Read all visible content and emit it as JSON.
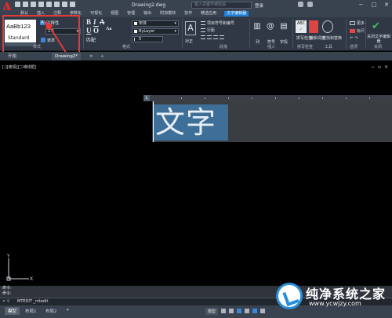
{
  "app": {
    "window_title": "Drawing2.dwg",
    "search_placeholder": "键入关键字或短语",
    "signin_label": "登录",
    "logo_letter": "A"
  },
  "ribbon_tabs": [
    "默认",
    "插入",
    "注释",
    "参数化",
    "可视化",
    "视图",
    "管理",
    "输出",
    "附加模块",
    "协作",
    "精选应用",
    "文字编辑器"
  ],
  "ribbon_active_tab": "文字编辑器",
  "ribbon": {
    "style": {
      "sample_text": "AaBb123",
      "sample_name": "Standard",
      "annotative_label": "注释性",
      "text_height": "2.5",
      "mask_label": "遮罩",
      "group_label": "样式"
    },
    "format": {
      "bold": "B",
      "italic": "I",
      "strike": "A",
      "underline": "U",
      "overline": "O",
      "case": "Aa",
      "font_value": "宋体",
      "color_value": "ByLayer",
      "oblique_value": "0",
      "match_label": "匹配",
      "group_label": "格式"
    },
    "paragraph": {
      "justify_label": "对正",
      "bullets_label": "项目符号和编号",
      "line_spacing_label": "行距",
      "group_label": "段落"
    },
    "insert": {
      "columns_label": "列",
      "symbol_label": "符号",
      "field_label": "字段",
      "group_label": "插入"
    },
    "spell": {
      "spell_check_label": "拼写检查",
      "edit_dict_label": "编辑词典",
      "find_replace_label": "查找和替换",
      "group_label": "拼写检查",
      "tools_label": "工具"
    },
    "options": {
      "more_label": "更多",
      "ruler_label": "标尺",
      "group_label": "选项"
    },
    "close": {
      "close_label": "关闭文字编辑器",
      "group_label": "关闭"
    }
  },
  "document_tabs": [
    {
      "label": "开始",
      "active": false
    },
    {
      "label": "Drawing2*",
      "active": true
    }
  ],
  "canvas": {
    "view_controls": "[-][俯视][二维线框]",
    "editor_text": "文字"
  },
  "command": {
    "history": [
      "命令:",
      "命令:"
    ],
    "current": "MTEDIT _mtedit"
  },
  "layout_tabs": [
    {
      "label": "模型",
      "active": true
    },
    {
      "label": "布局1",
      "active": false
    },
    {
      "label": "布局2",
      "active": false
    }
  ],
  "status": {
    "model_label": "模型"
  },
  "watermark": {
    "title": "纯净系统之家",
    "url": "www.ycwjzy.com"
  },
  "colors": {
    "accent": "#1f80d6",
    "highlight_border": "#e53935",
    "selection": "#3d6f99"
  }
}
